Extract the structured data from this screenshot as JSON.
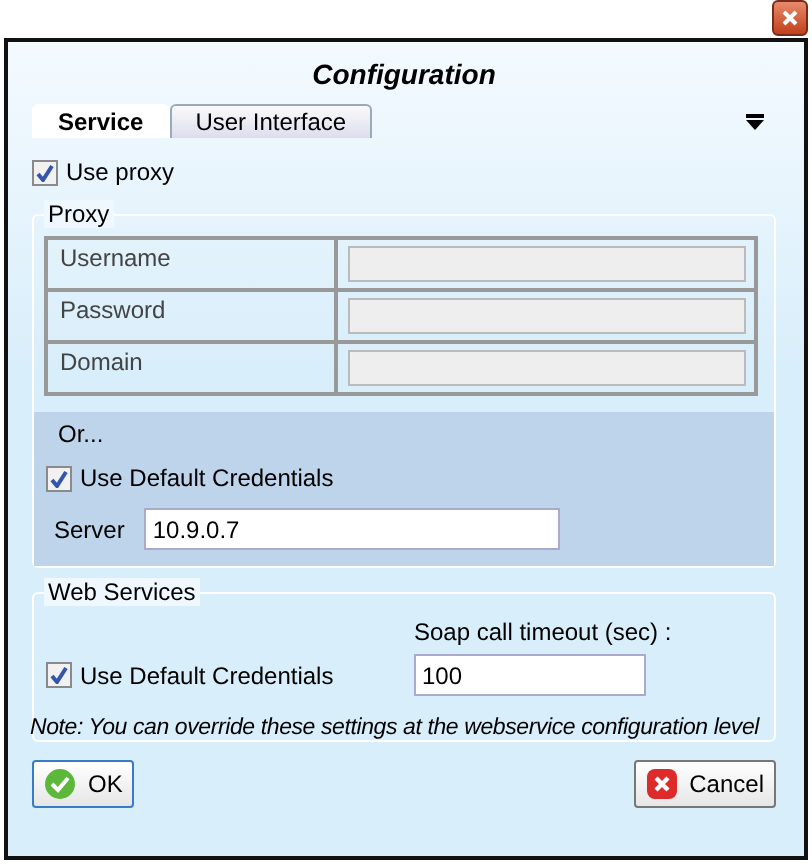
{
  "window": {
    "title": "Configuration"
  },
  "tabs": [
    {
      "label": "Service",
      "selected": true
    },
    {
      "label": "User Interface",
      "selected": false
    }
  ],
  "use_proxy": {
    "label": "Use proxy",
    "checked": true
  },
  "proxy": {
    "title": "Proxy",
    "fields": [
      {
        "label": "Username",
        "disabled": true
      },
      {
        "label": "Password",
        "disabled": true
      },
      {
        "label": "Domain",
        "disabled": true
      }
    ],
    "or_label": "Or...",
    "default_credentials": {
      "label": "Use Default Credentials",
      "checked": true
    },
    "server": {
      "label": "Server",
      "value": "10.9.0.7"
    }
  },
  "web_services": {
    "title": "Web Services",
    "default_credentials": {
      "label": "Use Default Credentials",
      "checked": true
    },
    "timeout": {
      "label": "Soap call timeout (sec) :",
      "value": "100"
    },
    "note": "Note: You can override these settings at the webservice configuration level"
  },
  "buttons": [
    {
      "kind": "ok",
      "label": "OK"
    },
    {
      "kind": "cancel",
      "label": "Cancel"
    }
  ]
}
